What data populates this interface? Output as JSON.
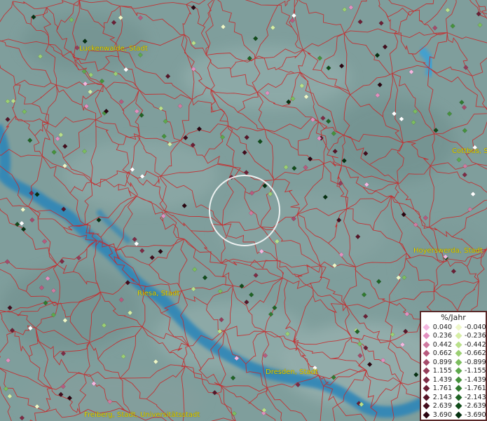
{
  "map": {
    "cities": [
      {
        "name": "Luckenwalde, Stadt"
      },
      {
        "name": "Cottbus, S"
      },
      {
        "name": "Hoyerswerda, Stadt"
      },
      {
        "name": "Riesa, Stadt"
      },
      {
        "name": "Dresden, Stadt"
      },
      {
        "name": "Freiberg, Stadt, Universitätsstadt"
      }
    ],
    "colors": {
      "background": "#7f9e9c",
      "boundary": "#c8282a",
      "river": "#3f97c4",
      "city_label": "#e6d400",
      "selection_circle": "#ffffff"
    }
  },
  "legend": {
    "title": "%/Jahr",
    "positive": [
      {
        "value": "0.040",
        "color": "#f4b6e0"
      },
      {
        "value": "0.236",
        "color": "#e38fbf"
      },
      {
        "value": "0.442",
        "color": "#d07aa0"
      },
      {
        "value": "0.662",
        "color": "#b85a7e"
      },
      {
        "value": "0.899",
        "color": "#a64b6b"
      },
      {
        "value": "1.155",
        "color": "#953d5a"
      },
      {
        "value": "1.439",
        "color": "#7e2b45"
      },
      {
        "value": "1.761",
        "color": "#6b1f35"
      },
      {
        "value": "2.143",
        "color": "#571528"
      },
      {
        "value": "2.639",
        "color": "#430c1c"
      },
      {
        "value": "3.690",
        "color": "#2a0510"
      }
    ],
    "negative": [
      {
        "value": "-0.040",
        "color": "#eef7c8"
      },
      {
        "value": "-0.236",
        "color": "#d6eea5"
      },
      {
        "value": "-0.442",
        "color": "#b9e08a"
      },
      {
        "value": "-0.662",
        "color": "#9bcf73"
      },
      {
        "value": "-0.899",
        "color": "#7cbd5e"
      },
      {
        "value": "-1.155",
        "color": "#5ea84c"
      },
      {
        "value": "-1.439",
        "color": "#46923c"
      },
      {
        "value": "-1.761",
        "color": "#317a2f"
      },
      {
        "value": "-2.143",
        "color": "#1f6324"
      },
      {
        "value": "-2.639",
        "color": "#114c1a"
      },
      {
        "value": "-3.690",
        "color": "#053010"
      }
    ]
  }
}
